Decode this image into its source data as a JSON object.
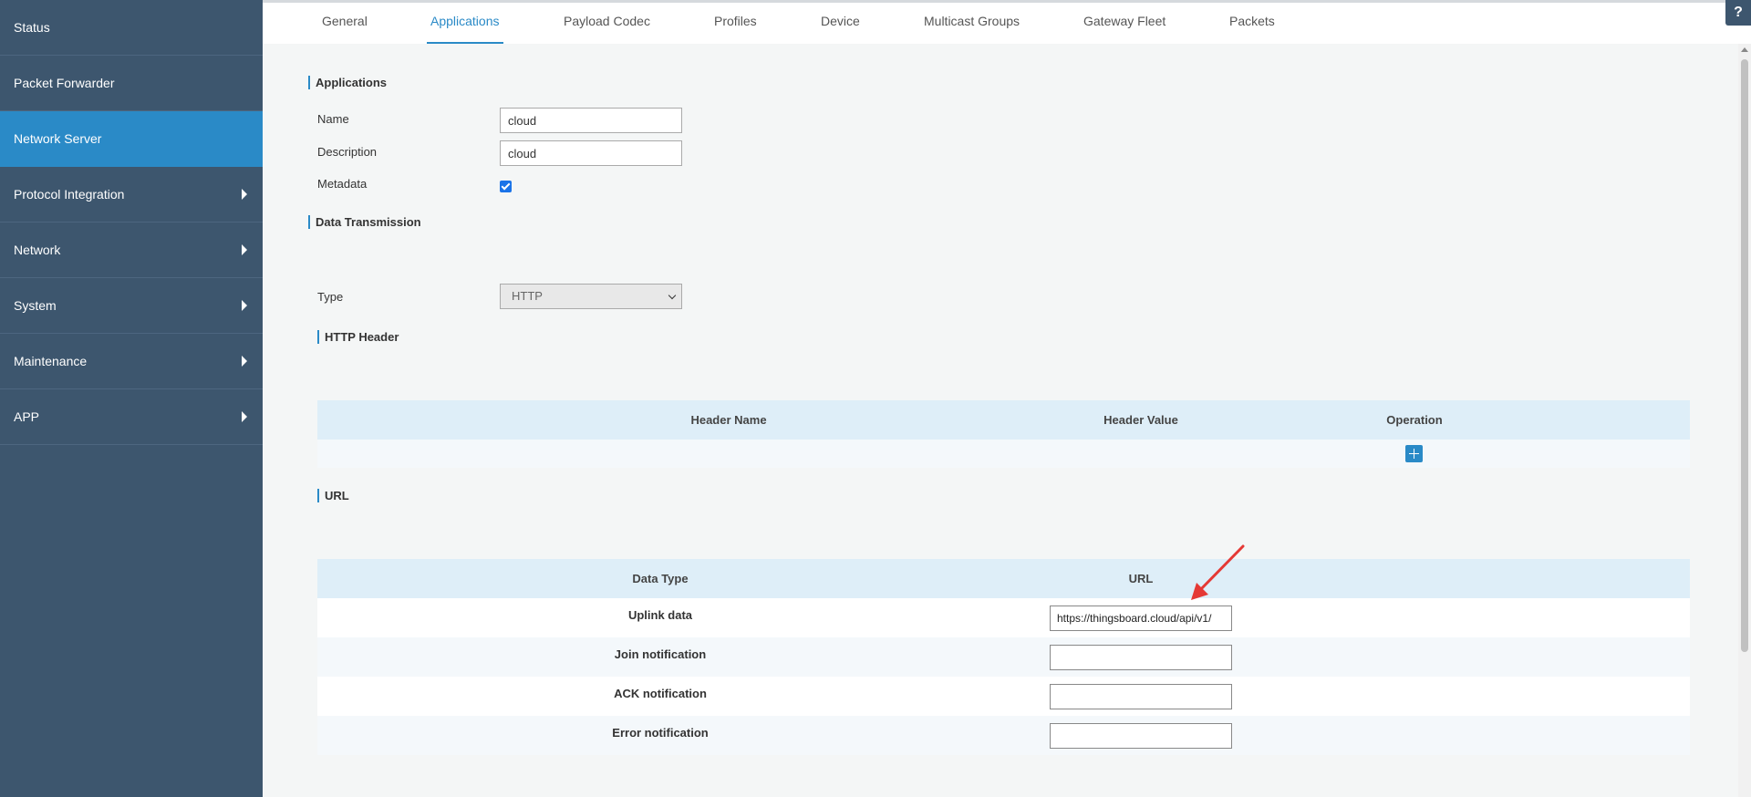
{
  "sidebar": {
    "items": [
      {
        "label": "Status",
        "has_submenu": false,
        "active": false
      },
      {
        "label": "Packet Forwarder",
        "has_submenu": false,
        "active": false
      },
      {
        "label": "Network Server",
        "has_submenu": false,
        "active": true
      },
      {
        "label": "Protocol Integration",
        "has_submenu": true,
        "active": false
      },
      {
        "label": "Network",
        "has_submenu": true,
        "active": false
      },
      {
        "label": "System",
        "has_submenu": true,
        "active": false
      },
      {
        "label": "Maintenance",
        "has_submenu": true,
        "active": false
      },
      {
        "label": "APP",
        "has_submenu": true,
        "active": false
      }
    ]
  },
  "tabs": {
    "items": [
      {
        "label": "General",
        "active": false
      },
      {
        "label": "Applications",
        "active": true
      },
      {
        "label": "Payload Codec",
        "active": false
      },
      {
        "label": "Profiles",
        "active": false
      },
      {
        "label": "Device",
        "active": false
      },
      {
        "label": "Multicast Groups",
        "active": false
      },
      {
        "label": "Gateway Fleet",
        "active": false
      },
      {
        "label": "Packets",
        "active": false
      }
    ]
  },
  "help": {
    "label": "?"
  },
  "applications": {
    "title": "Applications",
    "name_label": "Name",
    "name_value": "cloud",
    "description_label": "Description",
    "description_value": "cloud",
    "metadata_label": "Metadata",
    "metadata_checked": true
  },
  "data_transmission": {
    "title": "Data Transmission",
    "type_label": "Type",
    "type_value": "HTTP"
  },
  "http_header": {
    "title": "HTTP Header",
    "columns": [
      "Header Name",
      "Header Value",
      "Operation"
    ]
  },
  "url_section": {
    "title": "URL",
    "columns": [
      "Data Type",
      "URL"
    ],
    "rows": [
      {
        "data_type": "Uplink data",
        "url": "https://thingsboard.cloud/api/v1/"
      },
      {
        "data_type": "Join notification",
        "url": ""
      },
      {
        "data_type": "ACK notification",
        "url": ""
      },
      {
        "data_type": "Error notification",
        "url": ""
      }
    ]
  },
  "colors": {
    "sidebar_bg": "#3d566e",
    "accent": "#2a8ac7",
    "annotation_arrow": "#e53935"
  }
}
